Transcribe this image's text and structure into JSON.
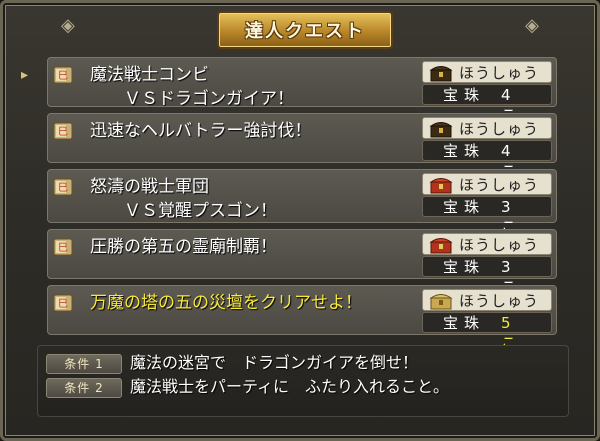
{
  "title": "達人クエスト",
  "reward_label": "ほうしゅう",
  "reward_item": "宝珠",
  "quests": [
    {
      "line1": "魔法戦士コンビ",
      "line2": "ＶＳドラゴンガイア！",
      "count": "4 こ",
      "chest": "dark",
      "highlight": false
    },
    {
      "line1": "迅速なヘルバトラー強討伐！",
      "line2": "",
      "count": "4 こ",
      "chest": "dark",
      "highlight": false
    },
    {
      "line1": "怒濤の戦士軍団",
      "line2": "ＶＳ覚醒プスゴン！",
      "count": "3 こ",
      "chest": "red",
      "highlight": false
    },
    {
      "line1": "圧勝の第五の霊廟制覇！",
      "line2": "",
      "count": "3 こ",
      "chest": "red",
      "highlight": false
    },
    {
      "line1": "万魔の塔の五の災壇をクリアせよ！",
      "line2": "",
      "count": "5 こ",
      "chest": "gold",
      "highlight": true
    }
  ],
  "conditions": [
    {
      "tag": "条件 1",
      "text": "魔法の迷宮で　ドラゴンガイアを倒せ！"
    },
    {
      "tag": "条件 2",
      "text": "魔法戦士をパーティに　ふたり入れること。"
    }
  ],
  "colors": {
    "highlight_text": "#f7e93a",
    "title_gold": "#d9a83f",
    "panel_bg": "#2e2c27"
  }
}
